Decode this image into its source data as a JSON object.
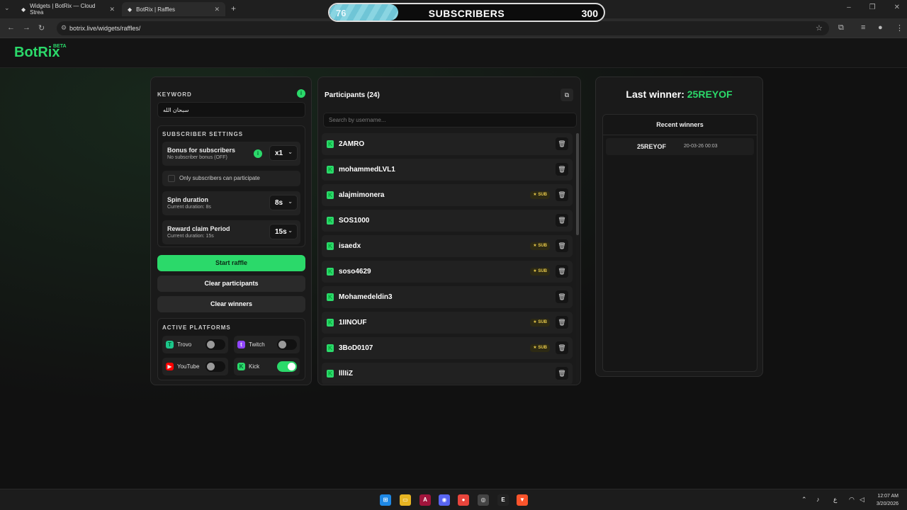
{
  "browser": {
    "tabs": [
      {
        "title": "Widgets | BotRix — Cloud Strea"
      },
      {
        "title": "BotRix | Raffles"
      }
    ],
    "url": "botrix.live/widgets/raffles/"
  },
  "subscriber_goal": {
    "current": "76",
    "label": "SUBSCRIBERS",
    "goal": "300",
    "progress": 0.25
  },
  "header": {
    "logo": "BotRix",
    "badge": "BETA"
  },
  "keyword": {
    "label": "KEYWORD",
    "value": "سبحان الله"
  },
  "subscriber_settings": {
    "title": "SUBSCRIBER SETTINGS",
    "bonus": {
      "title": "Bonus for subscribers",
      "sub": "No subscriber bonus (OFF)",
      "value": "x1"
    },
    "only_subs_label": "Only subscribers can participate",
    "spin": {
      "title": "Spin duration",
      "sub": "Current duration: 8s",
      "value": "8s"
    },
    "reward": {
      "title": "Reward claim Period",
      "sub": "Current duration: 15s",
      "value": "15s"
    }
  },
  "buttons": {
    "start": "Start raffle",
    "clear_participants": "Clear participants",
    "clear_winners": "Clear winners"
  },
  "platforms": {
    "title": "ACTIVE PLATFORMS",
    "items": [
      {
        "name": "Trovo",
        "enabled": false,
        "color": "#1cc68b"
      },
      {
        "name": "Twitch",
        "enabled": false,
        "color": "#9146ff"
      },
      {
        "name": "YouTube",
        "enabled": false,
        "color": "#ff0000"
      },
      {
        "name": "Kick",
        "enabled": true,
        "color": "#2bd96a"
      }
    ]
  },
  "participants": {
    "title": "Participants (24)",
    "search_placeholder": "Search by username...",
    "sub_badge": "SUB",
    "list": [
      {
        "name": "2AMRO",
        "sub": false
      },
      {
        "name": "mohammedLVL1",
        "sub": false
      },
      {
        "name": "alajmimonera",
        "sub": true
      },
      {
        "name": "SOS1000",
        "sub": false
      },
      {
        "name": "isaedx",
        "sub": true
      },
      {
        "name": "soso4629",
        "sub": true
      },
      {
        "name": "Mohamedeldin3",
        "sub": false
      },
      {
        "name": "1IINOUF",
        "sub": true
      },
      {
        "name": "3BoD0107",
        "sub": true
      },
      {
        "name": "lllIiZ",
        "sub": false
      }
    ]
  },
  "winner": {
    "label": "Last winner:",
    "name": "25REYOF",
    "recent_title": "Recent winners",
    "recent": [
      {
        "name": "25REYOF",
        "time": "20-03-26 00:03"
      }
    ]
  },
  "taskbar": {
    "lang": "ع",
    "time": "12:07 AM",
    "date": "3/20/2026"
  },
  "colors": {
    "accent": "#2bd96a",
    "background": "#111111",
    "panel": "#1a1a1a"
  }
}
